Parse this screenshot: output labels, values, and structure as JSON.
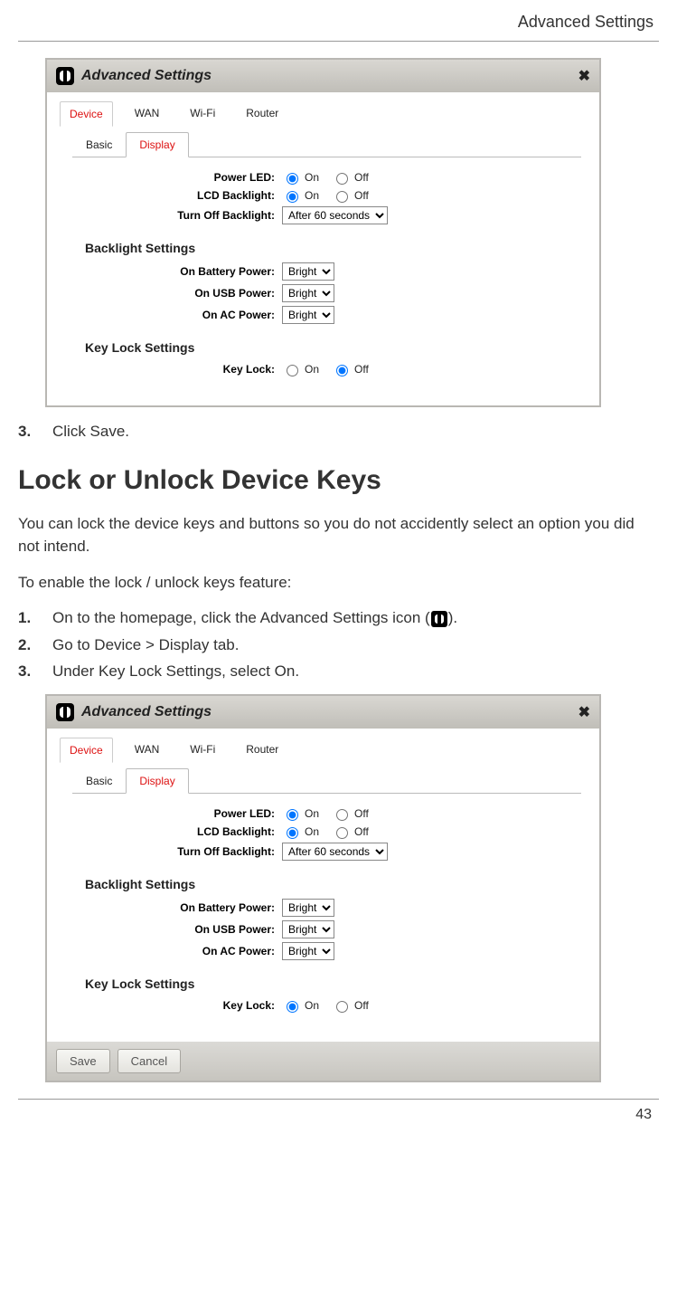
{
  "header": {
    "title": "Advanced Settings"
  },
  "page_number": "43",
  "step_before": {
    "number": "3.",
    "text": "Click Save."
  },
  "section_heading": "Lock or Unlock Device Keys",
  "section_intro": "You can lock the device keys and buttons so you do not accidently select an option you did not intend.",
  "section_intro2": "To enable the lock / unlock keys feature:",
  "steps": [
    {
      "number": "1.",
      "pre": "On to the homepage, click the Advanced Settings icon (",
      "post": ")."
    },
    {
      "number": "2.",
      "text": "Go to Device > Display tab."
    },
    {
      "number": "3.",
      "text": "Under Key Lock Settings, select On."
    }
  ],
  "panel1": {
    "title": "Advanced Settings",
    "tabs": [
      "Device",
      "WAN",
      "Wi-Fi",
      "Router"
    ],
    "subtabs": [
      "Basic",
      "Display"
    ],
    "labels": {
      "power_led": "Power LED:",
      "lcd_backlight": "LCD Backlight:",
      "turn_off_backlight": "Turn Off Backlight:",
      "backlight_settings": "Backlight Settings",
      "on_battery": "On Battery Power:",
      "on_usb": "On USB Power:",
      "on_ac": "On AC Power:",
      "keylock_settings": "Key Lock Settings",
      "key_lock": "Key Lock:",
      "on": "On",
      "off": "Off"
    },
    "values": {
      "turn_off_backlight": "After 60 seconds",
      "on_battery": "Bright",
      "on_usb": "Bright",
      "on_ac": "Bright",
      "power_led_on": true,
      "lcd_backlight_on": true,
      "key_lock_on": false
    }
  },
  "panel2": {
    "title": "Advanced Settings",
    "tabs": [
      "Device",
      "WAN",
      "Wi-Fi",
      "Router"
    ],
    "subtabs": [
      "Basic",
      "Display"
    ],
    "labels": {
      "power_led": "Power LED:",
      "lcd_backlight": "LCD Backlight:",
      "turn_off_backlight": "Turn Off Backlight:",
      "backlight_settings": "Backlight Settings",
      "on_battery": "On Battery Power:",
      "on_usb": "On USB Power:",
      "on_ac": "On AC Power:",
      "keylock_settings": "Key Lock Settings",
      "key_lock": "Key Lock:",
      "on": "On",
      "off": "Off"
    },
    "values": {
      "turn_off_backlight": "After 60 seconds",
      "on_battery": "Bright",
      "on_usb": "Bright",
      "on_ac": "Bright",
      "power_led_on": true,
      "lcd_backlight_on": true,
      "key_lock_on": true
    },
    "buttons": {
      "save": "Save",
      "cancel": "Cancel"
    }
  }
}
